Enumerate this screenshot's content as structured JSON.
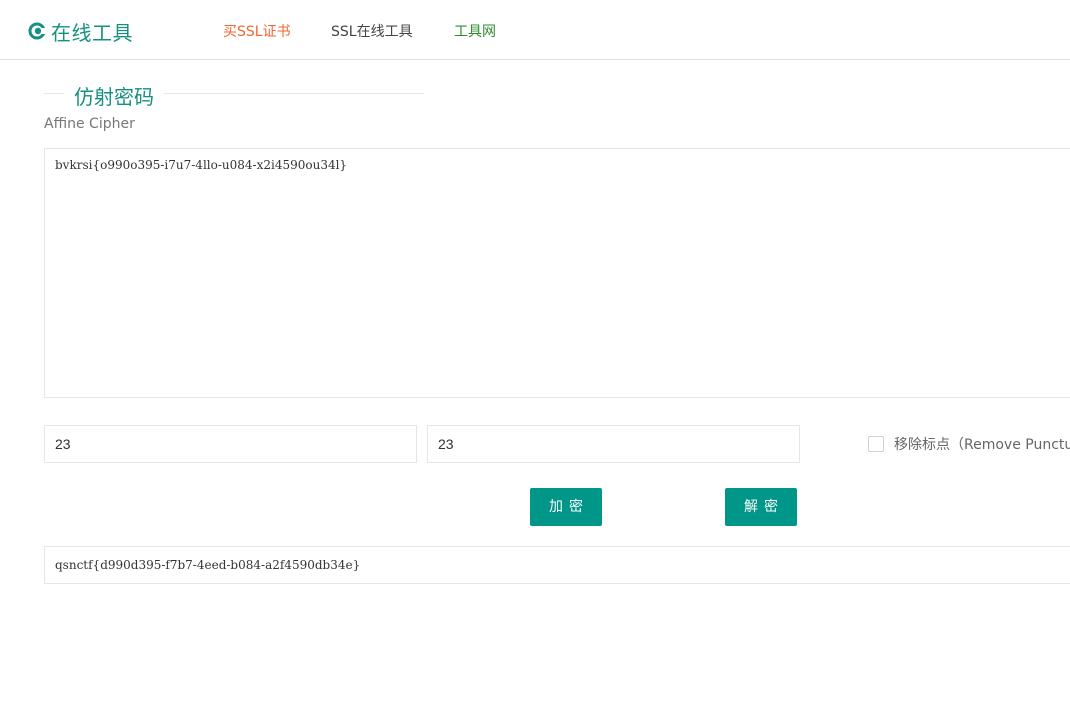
{
  "header": {
    "logo_icon": "eye-logo-icon",
    "logo_text": "在线工具",
    "nav": {
      "buy_ssl": "买SSL证书",
      "ssl_tools": "SSL在线工具",
      "tools_net": "工具网"
    },
    "colors": {
      "brand": "#16907f",
      "buy_ssl": "#f0642f",
      "tools_net": "#2e8b2e"
    }
  },
  "tool": {
    "title": "仿射密码",
    "subtitle": "Affine Cipher",
    "input_text": "bvkrsi{o990o395-i7u7-4llo-u084-x2i4590ou34l}",
    "key_a": "23",
    "key_b": "23",
    "remove_punct_label": "移除标点（Remove Punctuation）",
    "remove_punct_checked": false,
    "encrypt_label": "加密",
    "decrypt_label": "解密",
    "output_text": "qsnctf{d990d395-f7b7-4eed-b084-a2f4590db34e}",
    "accent_color": "#009688"
  }
}
